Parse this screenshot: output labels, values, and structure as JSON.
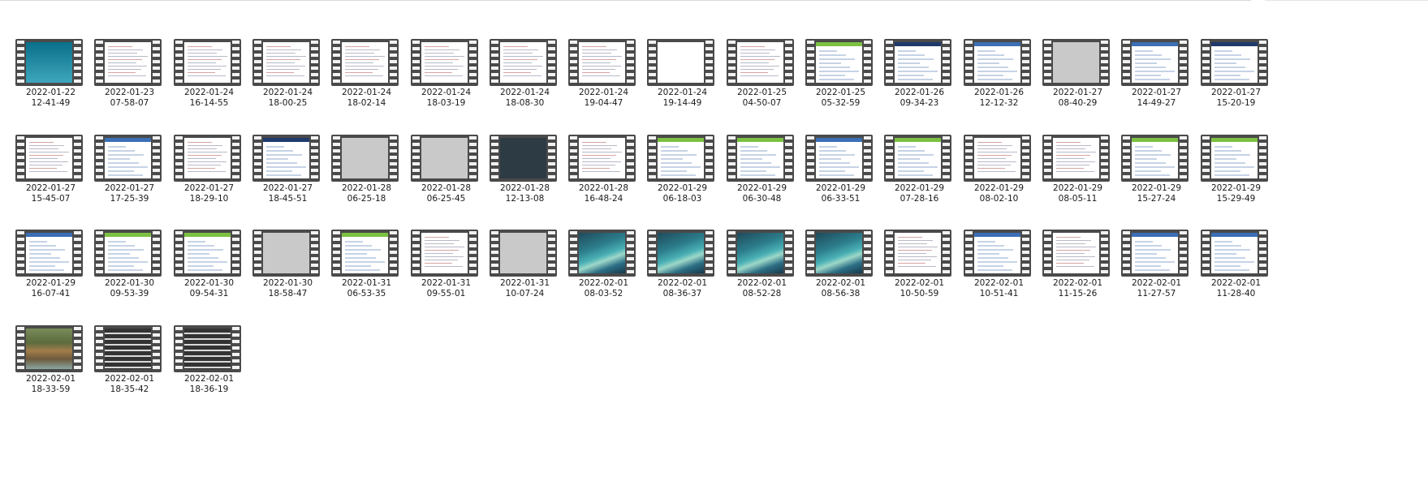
{
  "items": [
    {
      "date": "2022-01-22",
      "time": "12-41-49",
      "thumb": "vista"
    },
    {
      "date": "2022-01-23",
      "time": "07-58-07",
      "thumb": "doc"
    },
    {
      "date": "2022-01-24",
      "time": "16-14-55",
      "thumb": "doc"
    },
    {
      "date": "2022-01-24",
      "time": "18-00-25",
      "thumb": "doc"
    },
    {
      "date": "2022-01-24",
      "time": "18-02-14",
      "thumb": "doc"
    },
    {
      "date": "2022-01-24",
      "time": "18-03-19",
      "thumb": "doc"
    },
    {
      "date": "2022-01-24",
      "time": "18-08-30",
      "thumb": "doc"
    },
    {
      "date": "2022-01-24",
      "time": "19-04-47",
      "thumb": "doc"
    },
    {
      "date": "2022-01-24",
      "time": "19-14-49",
      "thumb": "blank"
    },
    {
      "date": "2022-01-25",
      "time": "04-50-07",
      "thumb": "doc"
    },
    {
      "date": "2022-01-25",
      "time": "05-32-59",
      "thumb": "web-green"
    },
    {
      "date": "2022-01-26",
      "time": "09-34-23",
      "thumb": "web-navy"
    },
    {
      "date": "2022-01-26",
      "time": "12-12-32",
      "thumb": "web-blue"
    },
    {
      "date": "2022-01-27",
      "time": "08-40-29",
      "thumb": "gray"
    },
    {
      "date": "2022-01-27",
      "time": "14-49-27",
      "thumb": "web-blue"
    },
    {
      "date": "2022-01-27",
      "time": "15-20-19",
      "thumb": "web-navy"
    },
    {
      "date": "2022-01-27",
      "time": "15-45-07",
      "thumb": "doc"
    },
    {
      "date": "2022-01-27",
      "time": "17-25-39",
      "thumb": "web-blue"
    },
    {
      "date": "2022-01-27",
      "time": "18-29-10",
      "thumb": "doc"
    },
    {
      "date": "2022-01-27",
      "time": "18-45-51",
      "thumb": "web-navy"
    },
    {
      "date": "2022-01-28",
      "time": "06-25-18",
      "thumb": "gray"
    },
    {
      "date": "2022-01-28",
      "time": "06-25-45",
      "thumb": "gray"
    },
    {
      "date": "2022-01-28",
      "time": "12-13-08",
      "thumb": "dark"
    },
    {
      "date": "2022-01-28",
      "time": "16-48-24",
      "thumb": "doc"
    },
    {
      "date": "2022-01-29",
      "time": "06-18-03",
      "thumb": "web-green"
    },
    {
      "date": "2022-01-29",
      "time": "06-30-48",
      "thumb": "web-green"
    },
    {
      "date": "2022-01-29",
      "time": "06-33-51",
      "thumb": "web-blue"
    },
    {
      "date": "2022-01-29",
      "time": "07-28-16",
      "thumb": "web-green"
    },
    {
      "date": "2022-01-29",
      "time": "08-02-10",
      "thumb": "doc"
    },
    {
      "date": "2022-01-29",
      "time": "08-05-11",
      "thumb": "doc"
    },
    {
      "date": "2022-01-29",
      "time": "15-27-24",
      "thumb": "web-green"
    },
    {
      "date": "2022-01-29",
      "time": "15-29-49",
      "thumb": "web-green"
    },
    {
      "date": "2022-01-29",
      "time": "16-07-41",
      "thumb": "web-blue"
    },
    {
      "date": "2022-01-30",
      "time": "09-53-39",
      "thumb": "web-green"
    },
    {
      "date": "2022-01-30",
      "time": "09-54-31",
      "thumb": "web-green"
    },
    {
      "date": "2022-01-30",
      "time": "18-58-47",
      "thumb": "gray"
    },
    {
      "date": "2022-01-31",
      "time": "06-53-35",
      "thumb": "web-green"
    },
    {
      "date": "2022-01-31",
      "time": "09-55-01",
      "thumb": "doc"
    },
    {
      "date": "2022-01-31",
      "time": "10-07-24",
      "thumb": "gray"
    },
    {
      "date": "2022-02-01",
      "time": "08-03-52",
      "thumb": "sea"
    },
    {
      "date": "2022-02-01",
      "time": "08-36-37",
      "thumb": "sea"
    },
    {
      "date": "2022-02-01",
      "time": "08-52-28",
      "thumb": "sea"
    },
    {
      "date": "2022-02-01",
      "time": "08-56-38",
      "thumb": "sea"
    },
    {
      "date": "2022-02-01",
      "time": "10-50-59",
      "thumb": "doc"
    },
    {
      "date": "2022-02-01",
      "time": "10-51-41",
      "thumb": "web-blue"
    },
    {
      "date": "2022-02-01",
      "time": "11-15-26",
      "thumb": "doc"
    },
    {
      "date": "2022-02-01",
      "time": "11-27-57",
      "thumb": "web-blue"
    },
    {
      "date": "2022-02-01",
      "time": "11-28-40",
      "thumb": "web-blue"
    },
    {
      "date": "2022-02-01",
      "time": "18-33-59",
      "thumb": "forest"
    },
    {
      "date": "2022-02-01",
      "time": "18-35-42",
      "thumb": "stair"
    },
    {
      "date": "2022-02-01",
      "time": "18-36-19",
      "thumb": "stair"
    }
  ],
  "colors": {
    "green": "#7cc142",
    "navy": "#1f3a6b",
    "blue": "#3b6fb6"
  }
}
